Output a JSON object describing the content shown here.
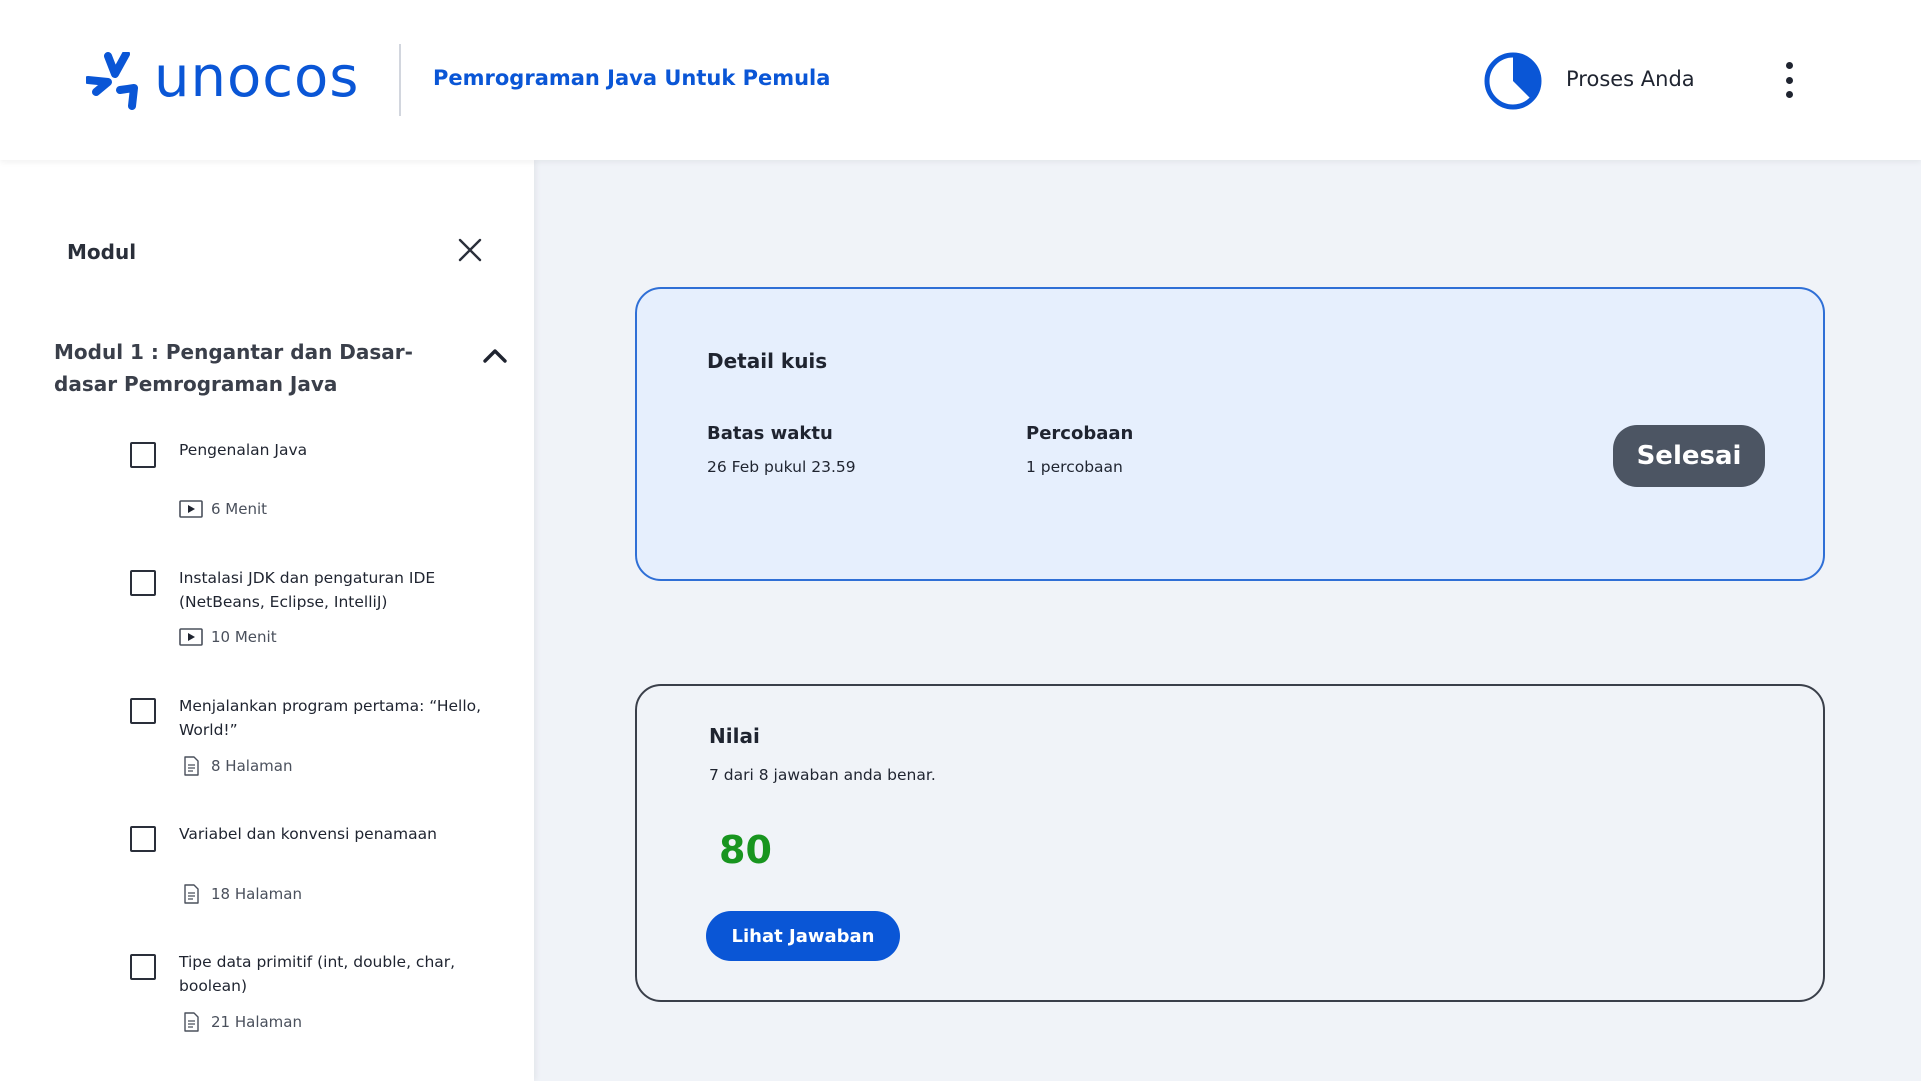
{
  "header": {
    "logo_text": "unocos",
    "course_title": "Pemrograman Java Untuk Pemula",
    "progress_label": "Proses Anda",
    "progress_fraction": 0.375,
    "brand_color": "#0a56d6",
    "icons": {
      "progress": "pie-progress-icon",
      "menu": "kebab-menu-icon"
    }
  },
  "sidebar": {
    "title": "Modul",
    "close_icon": "close-icon",
    "module": {
      "title": "Modul 1 : Pengantar dan Dasar-dasar Pemrograman Java",
      "expanded_icon": "chevron-up-icon",
      "lessons": [
        {
          "name": "Pengenalan Java",
          "meta": "6 Menit",
          "icon": "video-icon"
        },
        {
          "name": "Instalasi JDK dan pengaturan IDE (NetBeans, Eclipse, IntelliJ)",
          "meta": "10 Menit",
          "icon": "video-icon"
        },
        {
          "name": "Menjalankan program pertama: “Hello, World!”",
          "meta": "8 Halaman",
          "icon": "document-icon"
        },
        {
          "name": "Variabel dan konvensi penamaan",
          "meta": "18 Halaman",
          "icon": "document-icon"
        },
        {
          "name": "Tipe data primitif (int, double, char, boolean)",
          "meta": "21 Halaman",
          "icon": "document-icon"
        }
      ]
    }
  },
  "detail": {
    "title": "Detail kuis",
    "deadline_label": "Batas waktu",
    "deadline_value": "26 Feb pukul 23.59",
    "attempts_label": "Percobaan",
    "attempts_value": "1 percobaan",
    "done_button": "Selesai"
  },
  "nilai": {
    "title": "Nilai",
    "description": "7 dari 8 jawaban anda benar.",
    "score": "80",
    "score_color": "#18951f",
    "view_answers_button": "Lihat Jawaban"
  }
}
